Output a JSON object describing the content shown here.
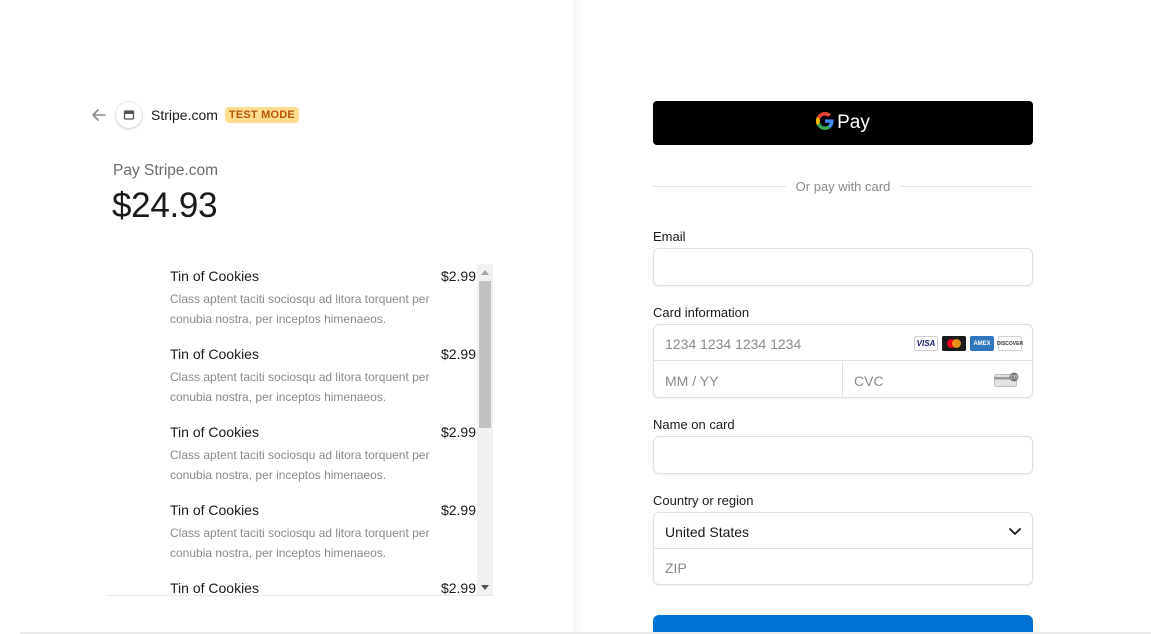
{
  "header": {
    "merchant_name": "Stripe.com",
    "badge": "TEST MODE",
    "icons": {
      "back": "arrow-left-icon",
      "logo": "store-icon"
    }
  },
  "summary": {
    "pay_label": "Pay Stripe.com",
    "amount": "$24.93"
  },
  "items": [
    {
      "name": "Tin of Cookies",
      "price": "$2.99",
      "description": "Class aptent taciti sociosqu ad litora torquent per conubia nostra, per inceptos himenaeos."
    },
    {
      "name": "Tin of Cookies",
      "price": "$2.99",
      "description": "Class aptent taciti sociosqu ad litora torquent per conubia nostra, per inceptos himenaeos."
    },
    {
      "name": "Tin of Cookies",
      "price": "$2.99",
      "description": "Class aptent taciti sociosqu ad litora torquent per conubia nostra, per inceptos himenaeos."
    },
    {
      "name": "Tin of Cookies",
      "price": "$2.99",
      "description": "Class aptent taciti sociosqu ad litora torquent per conubia nostra, per inceptos himenaeos."
    },
    {
      "name": "Tin of Cookies",
      "price": "$2.99",
      "description": ""
    }
  ],
  "form": {
    "gpay_label": "Pay",
    "divider_text": "Or pay with card",
    "email": {
      "label": "Email",
      "value": ""
    },
    "card": {
      "label": "Card information",
      "number_placeholder": "1234 1234 1234 1234",
      "expiry_placeholder": "MM / YY",
      "cvc_placeholder": "CVC",
      "brands": [
        "VISA",
        "mastercard",
        "AMEX",
        "DISCOVER"
      ]
    },
    "name": {
      "label": "Name on card",
      "value": ""
    },
    "country": {
      "label": "Country or region",
      "selected": "United States",
      "zip_placeholder": "ZIP"
    }
  },
  "colors": {
    "badge_bg": "#ffde92",
    "badge_text": "#bb5504",
    "pay_button": "#0074d4",
    "gpay_bg": "#000000"
  }
}
